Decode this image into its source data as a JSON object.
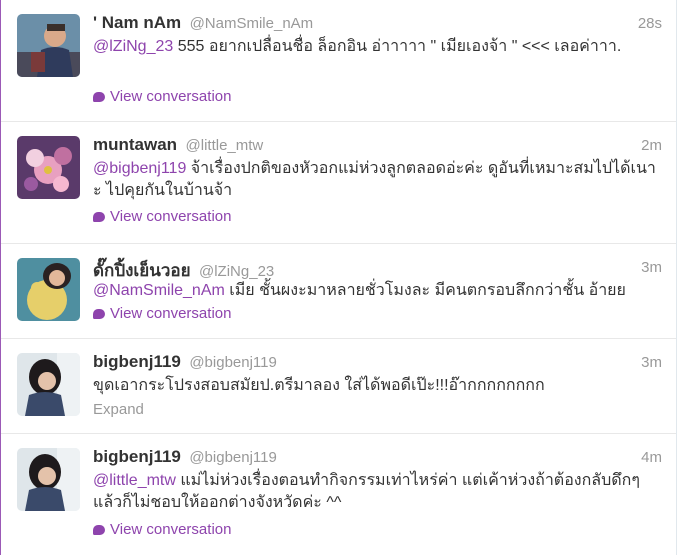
{
  "tweets": [
    {
      "name": "' Nam nAm",
      "handle": "@NamSmile_nAm",
      "time": "28s",
      "mention": "@lZiNg_23",
      "text": " 555 อยากเปลื่อนชื่อ ล็อกอิน อ่าาาาา \" เมียเองจ้า \" <<< เลอค่าาา.",
      "action": "View conversation"
    },
    {
      "name": "muntawan",
      "handle": "@little_mtw",
      "time": "2m",
      "mention": "@bigbenj119",
      "text": " จ้าเรื่องปกติของหัวอกแม่ห่วงลูกตลอดอ่ะค่ะ ดูอันที่เหมาะสมไปได้เนาะ ไปคุยกันในบ้านจ้า",
      "action": "View conversation"
    },
    {
      "name": "ดั๊กปิ้งเย็นวอย",
      "handle": "@lZiNg_23",
      "time": "3m",
      "mention": "@NamSmile_nAm",
      "text": " เมีย ชั้นผงะมาหลายชั่วโมงละ มีคนตกรอบลึกกว่าชั้น อ้ายย",
      "action": "View conversation"
    },
    {
      "name": "bigbenj119",
      "handle": "@bigbenj119",
      "time": "3m",
      "mention": "",
      "text": "ขุดเอากระโปรงสอบสมัยป.ตรีมาลอง ใส่ได้พอดีเป๊ะ!!!อ๊ากกกกกกกก",
      "action": "Expand"
    },
    {
      "name": "bigbenj119",
      "handle": "@bigbenj119",
      "time": "4m",
      "mention": "@little_mtw",
      "text": " แม่ไม่ห่วงเรื่องตอนทำกิจกรรมเท่าไหร่ค่า แต่เค้าห่วงถ้าต้องกลับดึกๆ แล้วก็ไม่ชอบให้ออกต่างจังหวัดค่ะ ^^",
      "action": "View conversation"
    }
  ],
  "colors": {
    "accent": "#8e44ad",
    "muted": "#999999",
    "text": "#333333"
  }
}
